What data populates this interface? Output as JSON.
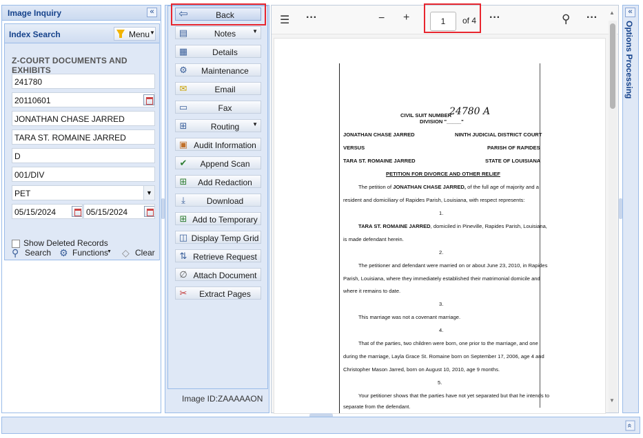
{
  "left_panel": {
    "title": "Image Inquiry",
    "collapse_glyph": "«",
    "index_search": {
      "title": "Index Search",
      "menu_label": "Menu",
      "section_title": "Z-COURT DOCUMENTS AND EXHIBITS",
      "fields": [
        {
          "value": " 241780"
        },
        {
          "value": "20110601"
        },
        {
          "value": "JONATHAN CHASE JARRED"
        },
        {
          "value": "TARA ST. ROMAINE JARRED"
        },
        {
          "value": "D"
        },
        {
          "value": "001/DIV"
        },
        {
          "value": "PET"
        }
      ],
      "date_from": "05/15/2024",
      "date_to": "05/15/2024",
      "show_deleted_label": "Show Deleted Records",
      "show_deleted_checked": false,
      "search_label": "Search",
      "functions_label": "Functions",
      "clear_label": "Clear"
    }
  },
  "actions": {
    "back": "Back",
    "notes": "Notes",
    "details": "Details",
    "maintenance": "Maintenance",
    "email": "Email",
    "fax": "Fax",
    "routing": "Routing",
    "audit": "Audit Information",
    "append_scan": "Append Scan",
    "add_redaction": "Add Redaction",
    "download": "Download",
    "add_temporary": "Add to Temporary",
    "display_temp_grid": "Display Temp Grid",
    "retrieve_request": "Retrieve Request",
    "attach_document": "Attach Document",
    "extract_pages": "Extract Pages",
    "image_id": "Image ID:ZAAAAAON"
  },
  "viewer": {
    "toolbar": {
      "list_icon": "list-icon",
      "more": "···",
      "zoom_out": "−",
      "zoom_in": "+",
      "page": "1",
      "page_of": "of 4",
      "search_icon": "search-icon"
    },
    "document": {
      "suit_line": "CIVIL SUIT NUMBER",
      "suit_handwritten": "24780  A",
      "division_line": "DIVISION \"_____\"",
      "plaintiff": "JONATHAN CHASE JARRED",
      "court": "NINTH JUDICIAL DISTRICT COURT",
      "versus": "VERSUS",
      "parish": "PARISH OF RAPIDES",
      "defendant": "TARA ST. ROMAINE JARRED",
      "state": "STATE OF LOUISIANA",
      "heading": "PETITION FOR DIVORCE AND OTHER RELIEF",
      "p0a_pre": "The petition of ",
      "p0a_bold": "JONATHAN CHASE JARRED,",
      "p0a_post": " of the full age of majority and a",
      "p0b": "resident and domiciliary of Rapides Parish, Louisiana, with respect represents:",
      "n1": "1.",
      "p1a_bold": "TARA ST. ROMAINE JARRED",
      "p1a_post": ", domiciled in Pineville, Rapides Parish, Louisiana,",
      "p1b": "is made defendant herein.",
      "n2": "2.",
      "p2a": "The petitioner and defendant were married on or about June 23, 2010, in Rapides",
      "p2b": "Parish, Louisiana, where they immediately established their matrimonial domicile and",
      "p2c": "where it remains to date.",
      "n3": "3.",
      "p3": "This marriage was not a covenant marriage.",
      "n4": "4.",
      "p4a": "That of the parties, two children were born, one prior to the marriage, and one",
      "p4b": "during the marriage, Layla Grace St. Romaine born on September 17, 2006, age 4 and",
      "p4c": "Christopher Mason Jarred, born on August 10, 2010, age 9 months.",
      "n5": "5.",
      "p5a": "Your petitioner shows that the parties have not yet separated but that he intends to",
      "p5b": "separate from the defendant."
    }
  },
  "right_panel": {
    "title": "Options Processing",
    "expand_glyph": "«"
  },
  "bottom_bar": {
    "expand_glyph": "»"
  },
  "colors": {
    "panel_border": "#99bbe8",
    "panel_bg": "#dfe8f6",
    "title_text": "#15428b",
    "highlight": "#e8252e"
  }
}
